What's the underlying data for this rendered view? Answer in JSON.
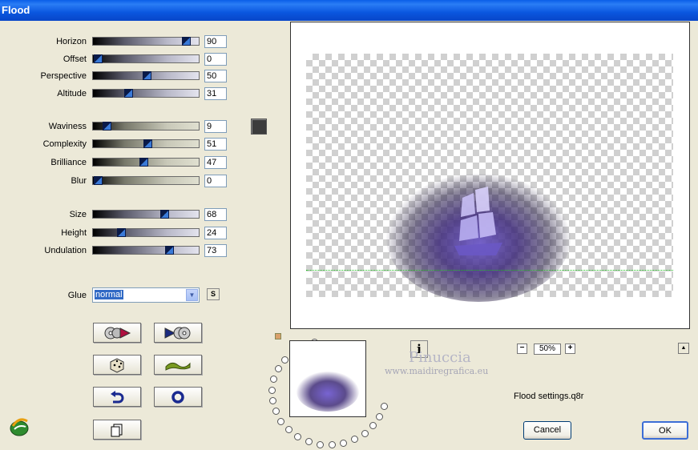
{
  "window": {
    "title": "Flood"
  },
  "sliders": [
    {
      "label": "Horizon",
      "value": "90",
      "level": 0.9,
      "style": "a"
    },
    {
      "label": "Offset",
      "value": "0",
      "level": 0.0,
      "style": "a"
    },
    {
      "label": "Perspective",
      "value": "50",
      "level": 0.5,
      "style": "a"
    },
    {
      "label": "Altitude",
      "value": "31",
      "level": 0.31,
      "style": "a"
    },
    {
      "label": "Waviness",
      "value": "9",
      "level": 0.09,
      "style": "b"
    },
    {
      "label": "Complexity",
      "value": "51",
      "level": 0.51,
      "style": "b"
    },
    {
      "label": "Brilliance",
      "value": "47",
      "level": 0.47,
      "style": "b"
    },
    {
      "label": "Blur",
      "value": "0",
      "level": 0.0,
      "style": "b"
    },
    {
      "label": "Size",
      "value": "68",
      "level": 0.68,
      "style": "a"
    },
    {
      "label": "Height",
      "value": "24",
      "level": 0.24,
      "style": "a"
    },
    {
      "label": "Undulation",
      "value": "73",
      "level": 0.73,
      "style": "a"
    }
  ],
  "color_swatch": "#3c3c3c",
  "glue": {
    "label": "Glue",
    "value": "normal"
  },
  "glue_side_button": "S",
  "tool_buttons": [
    {
      "name": "load-preset-button",
      "icon": "disc-arrow-icon"
    },
    {
      "name": "save-preset-button",
      "icon": "arrow-disc-icon"
    },
    {
      "name": "random-button",
      "icon": "dice-icon"
    },
    {
      "name": "animate-button",
      "icon": "wave-icon"
    },
    {
      "name": "undo-button",
      "icon": "undo-icon"
    },
    {
      "name": "reset-button",
      "icon": "ring-icon"
    },
    {
      "name": "copy-button",
      "icon": "copy-icon"
    }
  ],
  "info_button": "i",
  "watermark": {
    "line1": "Pinuccia",
    "line2": "www.maidiregrafica.eu"
  },
  "zoom": {
    "minus": "−",
    "value": "50%",
    "plus": "+"
  },
  "collapse_button": "▲",
  "settings_file": "Flood settings.q8r",
  "buttons": {
    "cancel": "Cancel",
    "ok": "OK"
  },
  "accent_colors": {
    "title_bar": "#0a56df",
    "knob": "#3a7ad8",
    "ship": "#7c6cd4"
  }
}
